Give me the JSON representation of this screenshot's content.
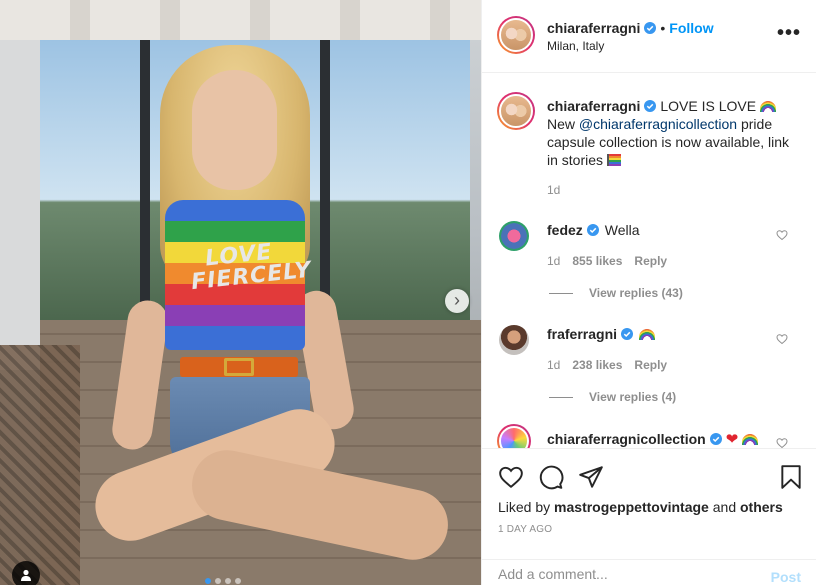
{
  "post": {
    "author": "chiaraferragni",
    "follow_label": "Follow",
    "separator": "•",
    "location": "Milan, Italy",
    "more_label": "•••"
  },
  "caption": {
    "username": "chiaraferragni",
    "text_1": "LOVE IS LOVE",
    "text_2": "New",
    "mention": "@chiaraferragnicollection",
    "text_3": "pride capsule collection is now available, link in stories",
    "time": "1d"
  },
  "comments": [
    {
      "username": "fedez",
      "text": "Wella",
      "time": "1d",
      "likes": "855 likes",
      "reply": "Reply",
      "view_replies": "View replies (43)"
    },
    {
      "username": "fraferragni",
      "text": "",
      "time": "1d",
      "likes": "238 likes",
      "reply": "Reply",
      "view_replies": "View replies (4)"
    },
    {
      "username": "chiaraferragnicollection",
      "text": ""
    }
  ],
  "photo": {
    "shirt_text_1": "LOVE",
    "shirt_text_2": "FIERCELY",
    "next_label": "›",
    "carousel_count": 4,
    "carousel_active": 1
  },
  "actions": {
    "liked_by_prefix": "Liked by",
    "liked_by_user": "mastrogeppettovintage",
    "and_label": "and",
    "others_label": "others",
    "time": "1 DAY AGO",
    "comment_placeholder": "Add a comment...",
    "post_label": "Post"
  },
  "colors": {
    "link_blue": "#0095f6",
    "verified_blue": "#3897f0",
    "muted": "#8e8e8e",
    "post_disabled": "#b2dffc"
  },
  "icons": [
    "verified-badge-icon",
    "more-icon",
    "heart-icon",
    "comment-icon",
    "share-icon",
    "bookmark-icon",
    "tag-user-icon",
    "next-arrow-icon"
  ]
}
